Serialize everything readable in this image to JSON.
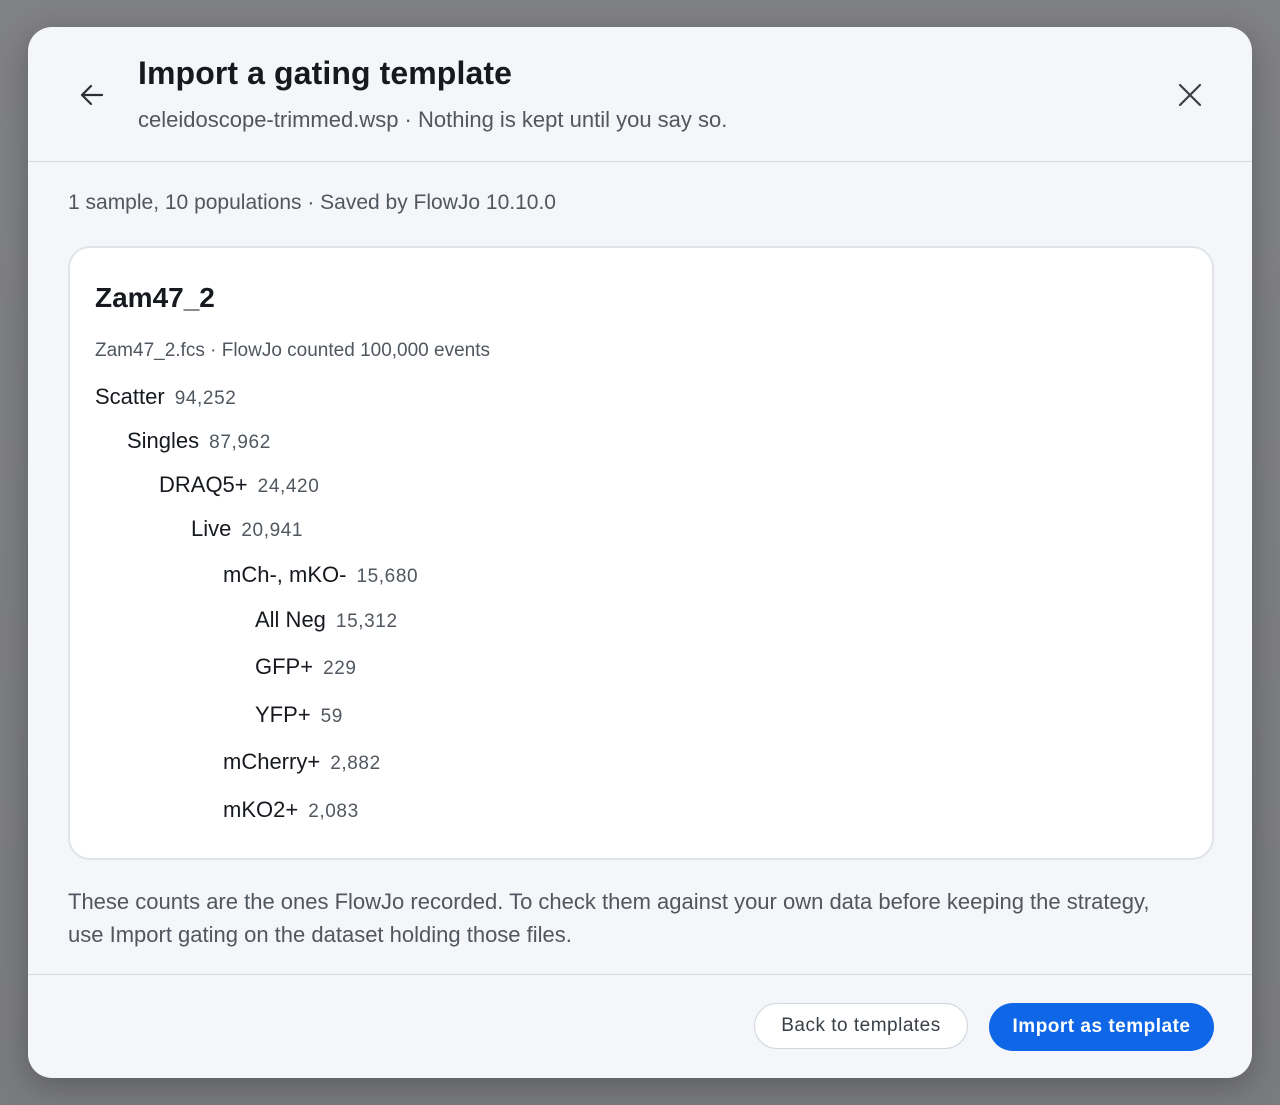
{
  "dialog": {
    "title": "Import a gating template",
    "subtitle": "celeidoscope-trimmed.wsp · Nothing is kept until you say so.",
    "back_icon": "arrow-left-icon",
    "close_icon": "close-icon"
  },
  "summary": "1 sample, 10 populations · Saved by FlowJo 10.10.0",
  "sample": {
    "name": "Zam47_2",
    "meta": "Zam47_2.fcs · FlowJo counted 100,000 events",
    "populations": [
      {
        "label": "Scatter",
        "count": "94,252",
        "depth": 0
      },
      {
        "label": "Singles",
        "count": "87,962",
        "depth": 1
      },
      {
        "label": "DRAQ5+",
        "count": "24,420",
        "depth": 2
      },
      {
        "label": "Live",
        "count": "20,941",
        "depth": 3
      },
      {
        "label": "mCh-, mKO-",
        "count": "15,680",
        "depth": 4
      },
      {
        "label": "All Neg",
        "count": "15,312",
        "depth": 5
      },
      {
        "label": "GFP+",
        "count": "229",
        "depth": 5
      },
      {
        "label": "YFP+",
        "count": "59",
        "depth": 5
      },
      {
        "label": "mCherry+",
        "count": "2,882",
        "depth": 4
      },
      {
        "label": "mKO2+",
        "count": "2,083",
        "depth": 4
      }
    ]
  },
  "note": "These counts are the ones FlowJo recorded. To check them against your own data before keeping the strategy, use Import gating on the dataset holding those files.",
  "footer": {
    "back_label": "Back to templates",
    "import_label": "Import as template"
  },
  "colors": {
    "primary": "#0f67e8",
    "backdrop": "#7c7d7f",
    "dialog_bg": "#f4f6f9"
  }
}
